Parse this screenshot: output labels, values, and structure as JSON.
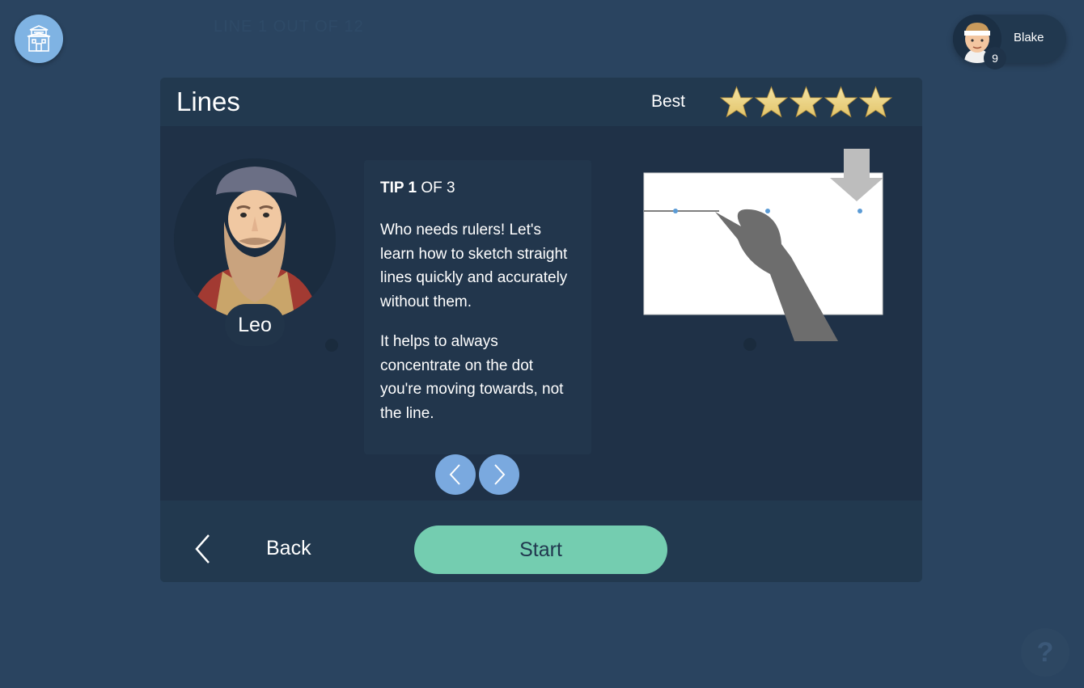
{
  "header": {
    "faded_title": "LINE 1 OUT OF 12",
    "home_icon": "building-icon"
  },
  "profile": {
    "name": "Blake",
    "level": "9",
    "avatar_icon": "avatar-icon"
  },
  "lesson": {
    "title": "Lines",
    "best_label": "Best",
    "star_rating": 5,
    "star_max": 5
  },
  "character": {
    "name": "Leo"
  },
  "tip": {
    "number_label": "TIP 1",
    "of_label": "OF 3",
    "paragraphs": [
      "Who needs rulers! Let's learn how to sketch straight lines quickly and accurately without them.",
      "It helps to always concentrate on the dot you're moving towards, not the line."
    ]
  },
  "footer": {
    "back_label": "Back",
    "start_label": "Start"
  },
  "help": {
    "label": "?"
  },
  "colors": {
    "background": "#2a4460",
    "accent_blue": "#7aa9df",
    "start_green": "#74cdb0",
    "star_gold": "#e2c46a"
  }
}
